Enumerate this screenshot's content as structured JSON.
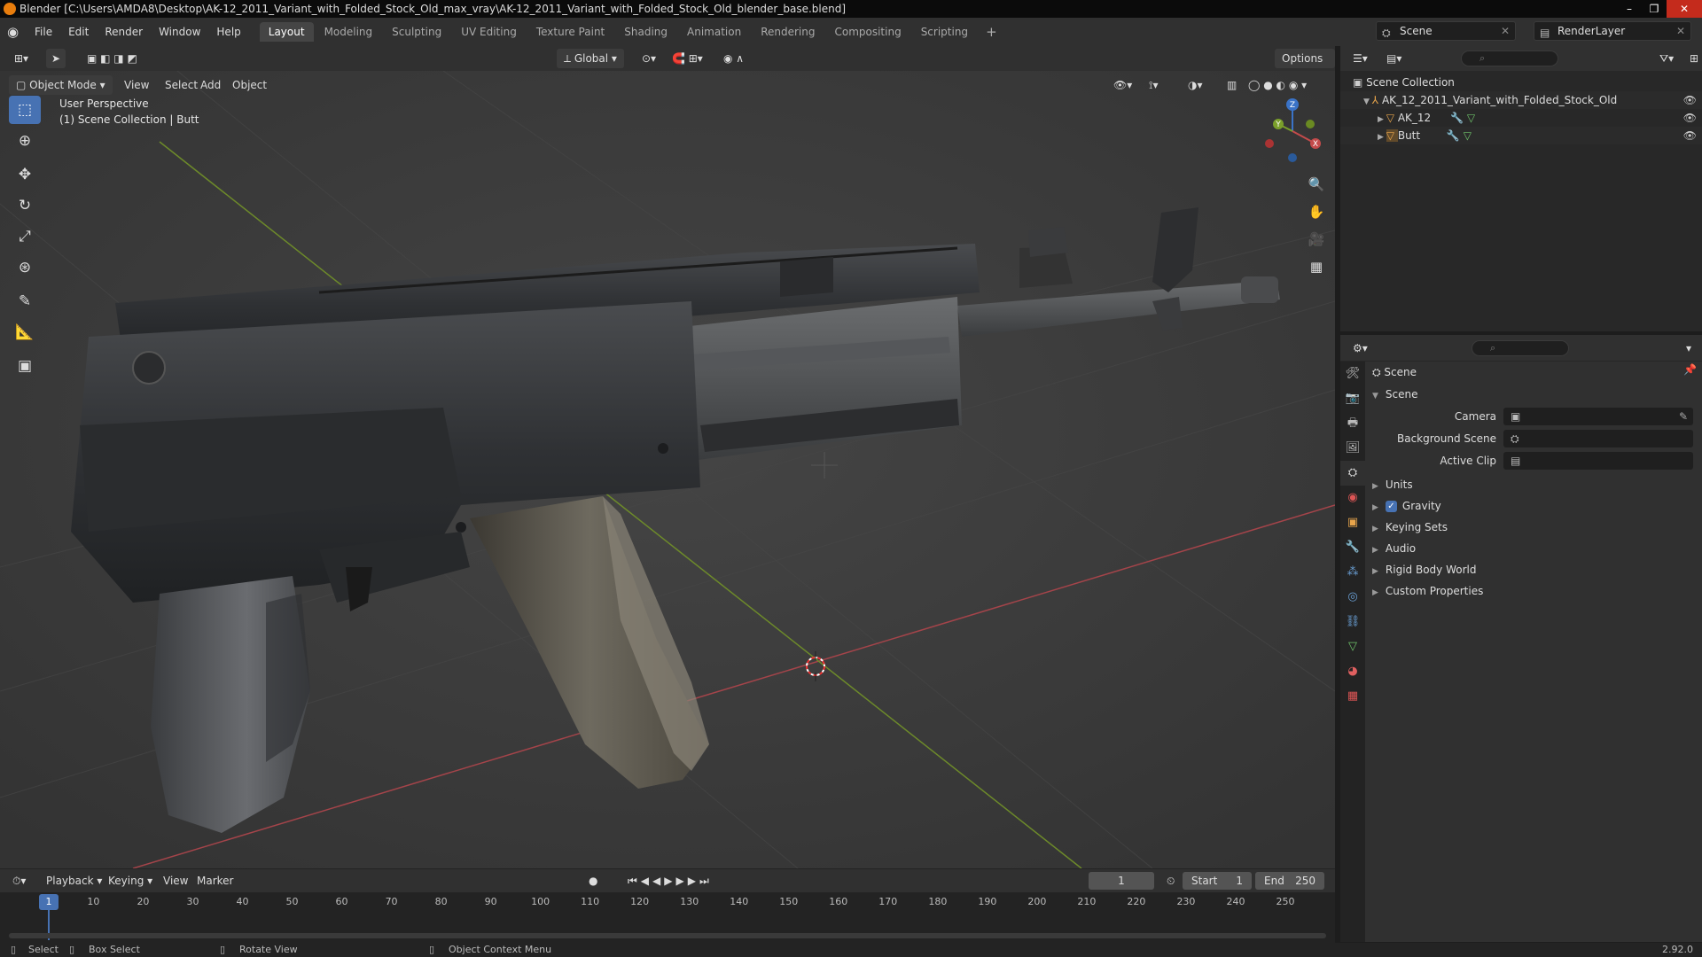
{
  "window": {
    "title": "Blender [C:\\Users\\AMDA8\\Desktop\\AK-12_2011_Variant_with_Folded_Stock_Old_max_vray\\AK-12_2011_Variant_with_Folded_Stock_Old_blender_base.blend]"
  },
  "menu": {
    "items": [
      "File",
      "Edit",
      "Render",
      "Window",
      "Help"
    ]
  },
  "workspaces": [
    "Layout",
    "Modeling",
    "Sculpting",
    "UV Editing",
    "Texture Paint",
    "Shading",
    "Animation",
    "Rendering",
    "Compositing",
    "Scripting"
  ],
  "scene_selector": {
    "scene": "Scene",
    "view_layer": "RenderLayer"
  },
  "viewport_header": {
    "transform_orientation": "Global",
    "options_label": "Options",
    "mode": "Object Mode",
    "menus": [
      "View",
      "Select",
      "Add",
      "Object"
    ]
  },
  "viewport": {
    "perspective_label": "User Perspective",
    "collection_label": "(1) Scene Collection | Butt"
  },
  "gizmo": {
    "x": "X",
    "y": "Y",
    "z": "Z"
  },
  "outliner": {
    "root": "Scene Collection",
    "items": [
      {
        "name": "AK_12_2011_Variant_with_Folded_Stock_Old"
      },
      {
        "name": "AK_12"
      },
      {
        "name": "Butt"
      }
    ]
  },
  "properties": {
    "context_title": "Scene",
    "panel_title": "Scene",
    "fields": {
      "camera": "Camera",
      "background_scene": "Background Scene",
      "active_clip": "Active Clip"
    },
    "sections": [
      "Units",
      "Gravity",
      "Keying Sets",
      "Audio",
      "Rigid Body World",
      "Custom Properties"
    ],
    "gravity_enabled": true
  },
  "timeline": {
    "menus": [
      "Playback",
      "Keying",
      "View",
      "Marker"
    ],
    "current_frame": "1",
    "start_label": "Start",
    "start_value": "1",
    "end_label": "End",
    "end_value": "250",
    "ruler": [
      "1",
      "10",
      "20",
      "30",
      "40",
      "50",
      "60",
      "70",
      "80",
      "90",
      "100",
      "110",
      "120",
      "130",
      "140",
      "150",
      "160",
      "170",
      "180",
      "190",
      "200",
      "210",
      "220",
      "230",
      "240",
      "250"
    ]
  },
  "statusbar": {
    "select": "Select",
    "box_select": "Box Select",
    "rotate_view": "Rotate View",
    "context_menu": "Object Context Menu",
    "version": "2.92.0"
  },
  "colors": {
    "accent": "#4772b3",
    "x_axis": "#c44b4b",
    "y_axis": "#7a9f2a",
    "z_axis": "#3a73c7"
  }
}
